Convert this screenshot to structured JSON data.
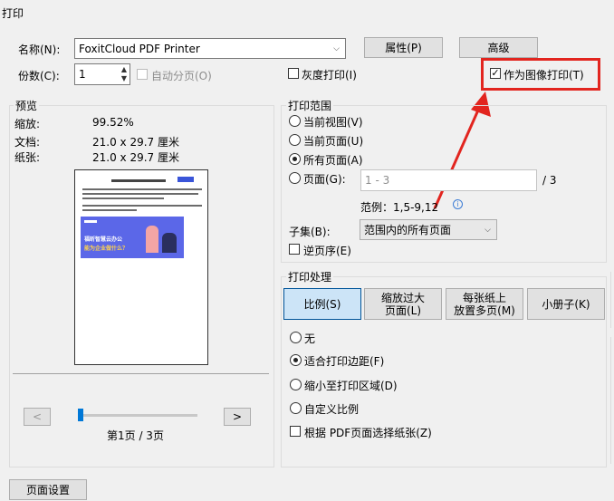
{
  "window": {
    "title": "打印"
  },
  "printer": {
    "name_label": "名称(N):",
    "selected": "FoxitCloud PDF Printer"
  },
  "buttons": {
    "properties": "属性(P)",
    "advanced": "高级",
    "page_setup": "页面设置"
  },
  "copies": {
    "label": "份数(C):",
    "value": "1",
    "collate_label": "自动分页(O)"
  },
  "options": {
    "grayscale_label": "灰度打印(I)",
    "print_as_image_label": "作为图像打印(T)",
    "print_as_image_checked": true
  },
  "preview": {
    "title": "预览",
    "zoom_label": "缩放:",
    "zoom_value": "99.52%",
    "document_label": "文档:",
    "document_value": "21.0 x 29.7 厘米",
    "paper_label": "纸张:",
    "paper_value": "21.0 x 29.7 厘米",
    "page_indicator": "第1页 / 3页",
    "prev": "<",
    "next": ">",
    "slider_fraction": 0.0,
    "banner_text_line1": "福昕智慧云办公",
    "banner_text_line2": "能为企业做什么？"
  },
  "print_range": {
    "title": "打印范围",
    "options": [
      {
        "label": "当前视图(V)",
        "selected": false
      },
      {
        "label": "当前页面(U)",
        "selected": false
      },
      {
        "label": "所有页面(A)",
        "selected": true
      },
      {
        "label": "页面(G):",
        "selected": false
      }
    ],
    "pages_placeholder": "1 - 3",
    "total_pages": "/ 3",
    "example": "范例：1,5-9,12",
    "subset_label": "子集(B):",
    "subset_value": "范围内的所有页面",
    "reverse_label": "逆页序(E)"
  },
  "print_handling": {
    "title": "打印处理",
    "tabs": [
      "比例(S)",
      "缩放过大页面(L)",
      "每张纸上放置多页(M)",
      "小册子(K)"
    ],
    "tabs_line1": [
      "比例(S)",
      "缩放过大",
      "每张纸上",
      "小册子(K)"
    ],
    "tabs_line2": [
      "",
      "页面(L)",
      "放置多页(M)",
      ""
    ],
    "active_tab": 0,
    "options": [
      {
        "label": "无",
        "selected": false
      },
      {
        "label": "适合打印边距(F)",
        "selected": true
      },
      {
        "label": "缩小至打印区域(D)",
        "selected": false
      },
      {
        "label": "自定义比例",
        "selected": false
      }
    ],
    "choose_paper_label": "根据 PDF页面选择纸张(Z)"
  },
  "colors": {
    "highlight": "#e2251f",
    "tab_selected": "#cce4f7",
    "banner": "#5b67e8"
  }
}
